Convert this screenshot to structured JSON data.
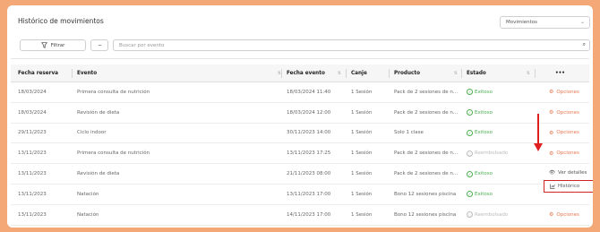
{
  "page": {
    "title": "Histórico de movimientos"
  },
  "selector": {
    "value": "Movimientos"
  },
  "toolbar": {
    "filter_label": "Filtrar",
    "more_label": "···",
    "search_placeholder": "Buscar por evento"
  },
  "table": {
    "headers": {
      "fecha_reserva": "Fecha reserva",
      "evento": "Evento",
      "fecha_evento": "Fecha evento",
      "canje": "Canje",
      "producto": "Producto",
      "estado": "Estado",
      "actions": "•••"
    },
    "rows": [
      {
        "fecha_reserva": "18/03/2024",
        "evento": "Primera consulta de nutrición",
        "fecha_evento": "18/03/2024 11:40",
        "canje": "1 Sesión",
        "producto": "Pack de 2 sesiones de n...",
        "estado": "Exitoso",
        "estado_type": "ok",
        "accion": "Opciones"
      },
      {
        "fecha_reserva": "18/03/2024",
        "evento": "Revisión de dieta",
        "fecha_evento": "18/03/2024 12:00",
        "canje": "1 Sesión",
        "producto": "Pack de 2 sesiones de n...",
        "estado": "Exitoso",
        "estado_type": "ok",
        "accion": "Opciones"
      },
      {
        "fecha_reserva": "29/11/2023",
        "evento": "Ciclo indoor",
        "fecha_evento": "30/11/2023 14:00",
        "canje": "1 Sesión",
        "producto": "Solo 1 clase",
        "estado": "Exitoso",
        "estado_type": "ok",
        "accion": "Opciones"
      },
      {
        "fecha_reserva": "13/11/2023",
        "evento": "Primera consulta de nutrición",
        "fecha_evento": "13/11/2023 17:25",
        "canje": "1 Sesión",
        "producto": "Pack de 2 sesiones de n...",
        "estado": "Reembolsado",
        "estado_type": "pend",
        "accion": "Opciones"
      },
      {
        "fecha_reserva": "13/11/2023",
        "evento": "Revisión de dieta",
        "fecha_evento": "21/11/2023 08:00",
        "canje": "1 Sesión",
        "producto": "Pack de 2 sesiones de n...",
        "estado": "Exitoso",
        "estado_type": "ok",
        "accion": ""
      },
      {
        "fecha_reserva": "13/11/2023",
        "evento": "Natación",
        "fecha_evento": "13/11/2023 17:00",
        "canje": "1 Sesión",
        "producto": "Bono 12 sesiones piscina",
        "estado": "Exitoso",
        "estado_type": "ok",
        "accion": "Opciones"
      },
      {
        "fecha_reserva": "13/11/2023",
        "evento": "Natación",
        "fecha_evento": "14/11/2023 17:00",
        "canje": "1 Sesión",
        "producto": "Bono 12 sesiones piscina",
        "estado": "Reembolsado",
        "estado_type": "pend",
        "accion": "Opciones"
      }
    ]
  },
  "dropdown": {
    "ver_detalles": "Ver detalles",
    "historico": "Histórico"
  },
  "colors": {
    "accent": "#e8764e",
    "success": "#4caf50",
    "highlight": "#d32222",
    "frame": "#f4a878"
  },
  "icons": {
    "filter": "filter-icon",
    "search": "search-icon",
    "gear": "gear-icon",
    "eye": "eye-icon",
    "chart": "chart-icon",
    "check": "check-circle-icon"
  }
}
